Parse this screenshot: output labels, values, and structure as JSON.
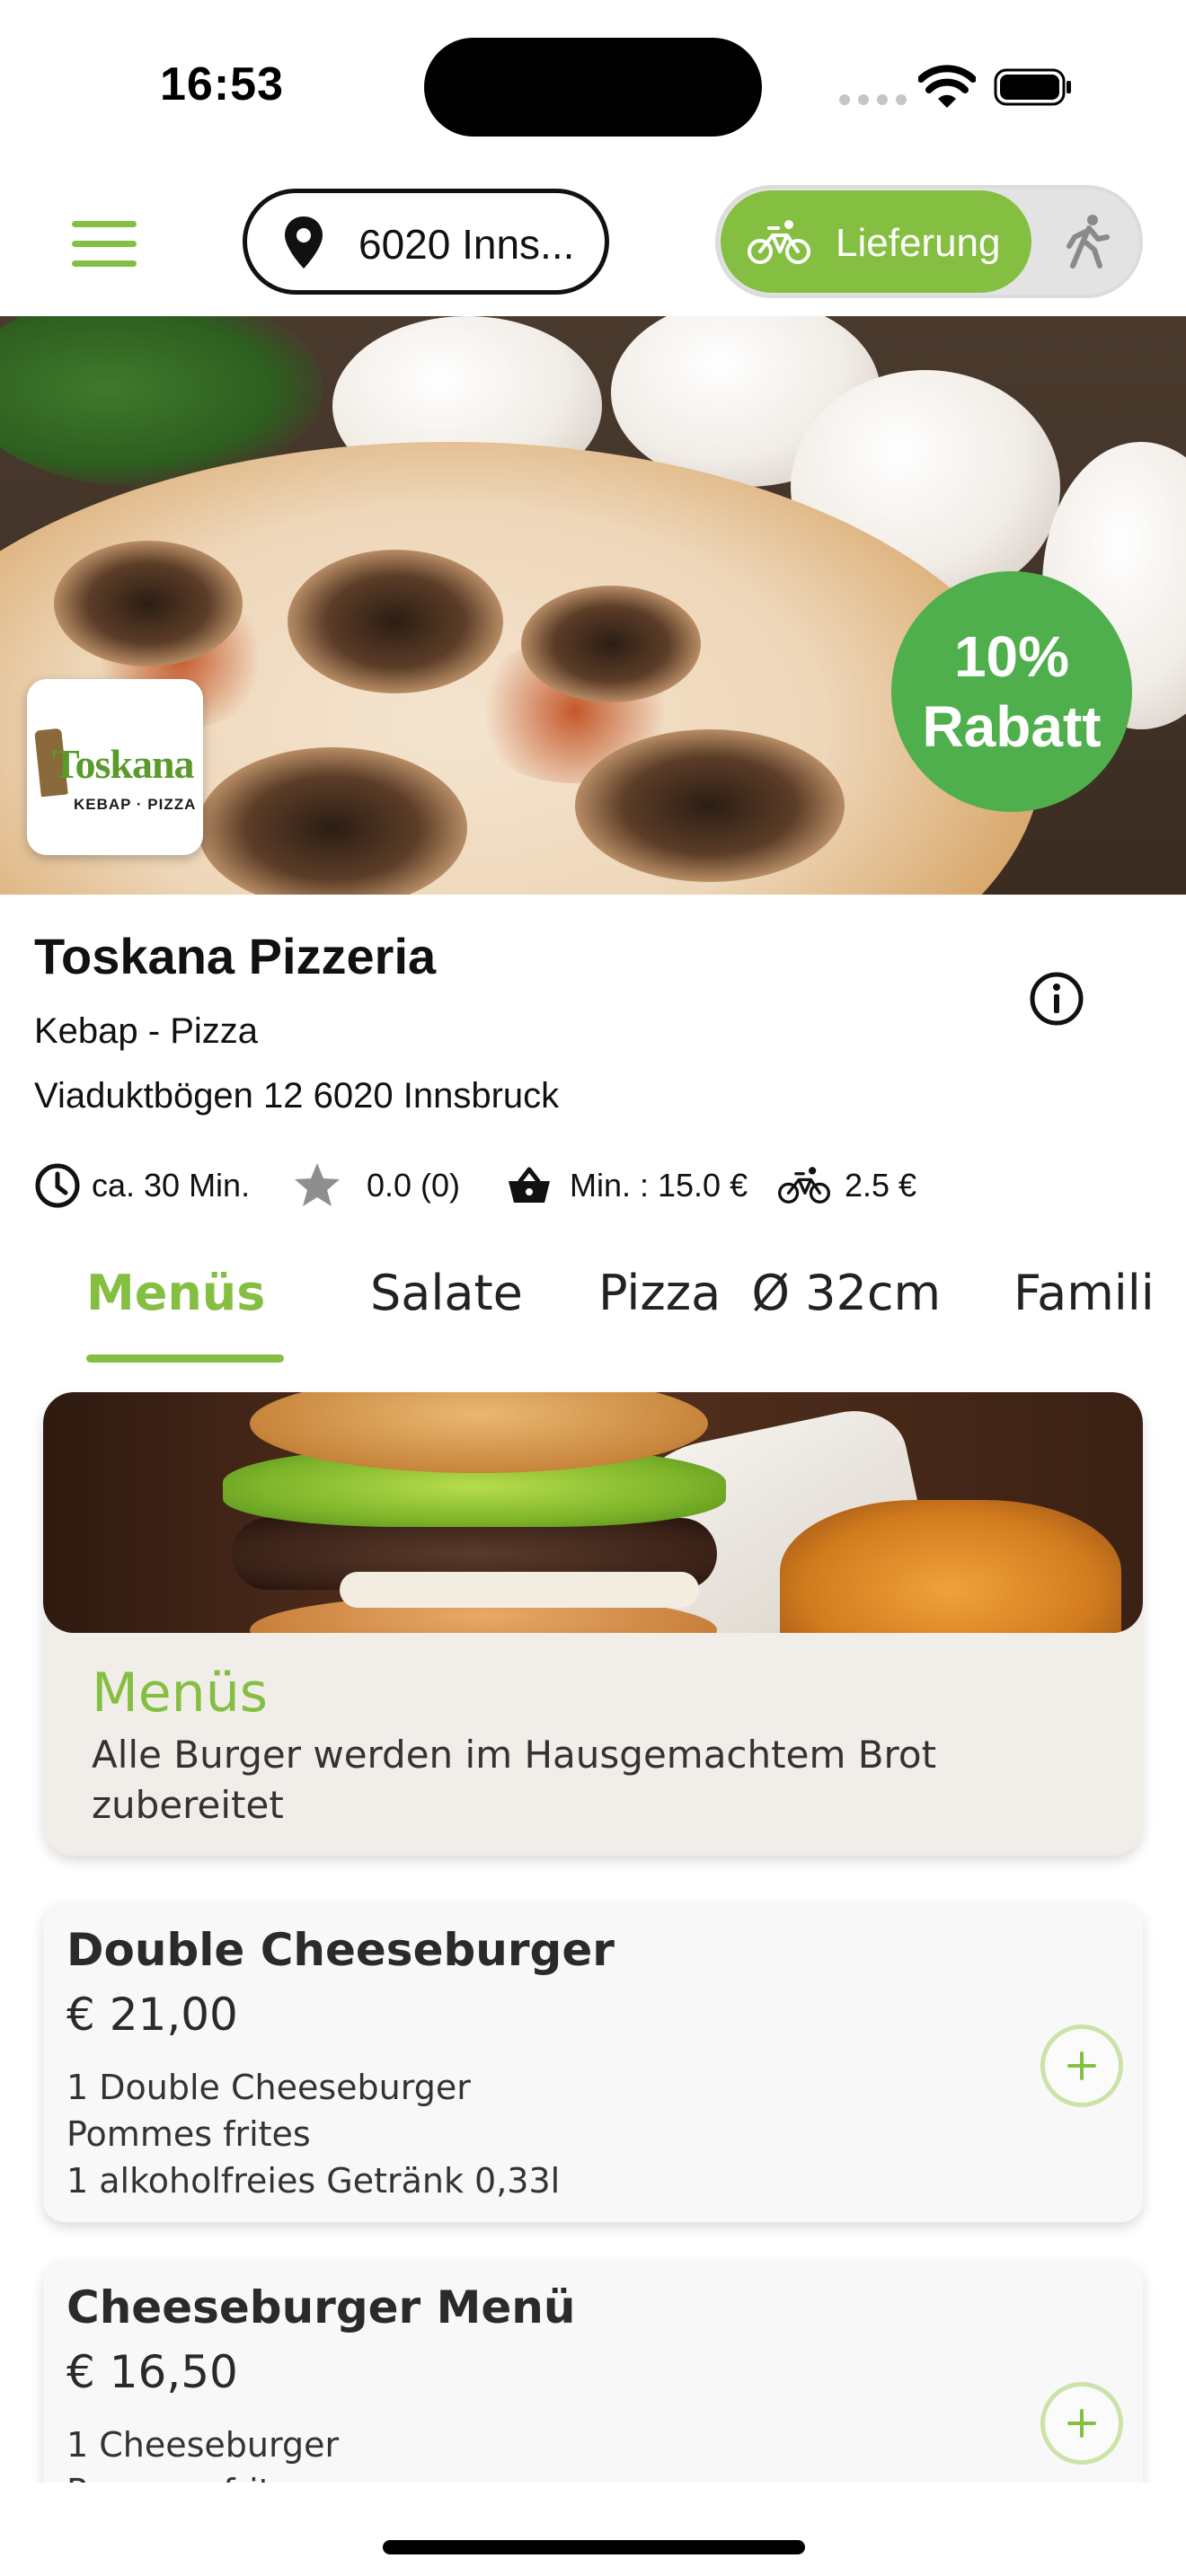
{
  "status_bar": {
    "time": "16:53"
  },
  "header": {
    "location": "6020 Inns...",
    "delivery_mode_label": "Lieferung",
    "delivery_mode_selected": "Lieferung",
    "accent_color": "#85bf42"
  },
  "hero": {
    "logo_name": "Toskana",
    "logo_subtitle": "KEBAP · PIZZA",
    "discount_line1": "10%",
    "discount_line2": "Rabatt",
    "discount_color": "#4faf4c"
  },
  "restaurant": {
    "name": "Toskana Pizzeria",
    "subtitle": "Kebap - Pizza",
    "address": "Viaduktbögen 12 6020 Innsbruck",
    "delivery_time": "ca. 30 Min.",
    "rating": "0.0 (0)",
    "min_order": "Min. : 15.0 €",
    "delivery_fee": "2.5 €"
  },
  "tabs": [
    {
      "label": "Menüs",
      "active": true
    },
    {
      "label": "Salate",
      "active": false
    },
    {
      "label": "Pizza  Ø 32cm",
      "active": false
    },
    {
      "label": "Famili",
      "active": false
    }
  ],
  "category": {
    "title": "Menüs",
    "description": "Alle Burger werden im Hausgemachtem Brot zubereitet"
  },
  "products": [
    {
      "name": "Double Cheeseburger",
      "price": "€ 21,00",
      "lines": [
        "1 Double Cheeseburger",
        "Pommes frites",
        "1 alkoholfreies Getränk 0,33l"
      ]
    },
    {
      "name": "Cheeseburger Menü",
      "price": "€ 16,50",
      "lines": [
        "1 Cheeseburger",
        "Pommes frites"
      ]
    }
  ],
  "icons": {
    "menu": "hamburger-menu-icon",
    "location": "location-pin-icon",
    "delivery": "bicycle-icon",
    "pickup": "walking-person-icon",
    "info": "info-icon",
    "time": "clock-icon",
    "rating": "star-icon",
    "min_order": "basket-icon",
    "fee": "bicycle-icon",
    "add": "plus-circle-icon"
  }
}
